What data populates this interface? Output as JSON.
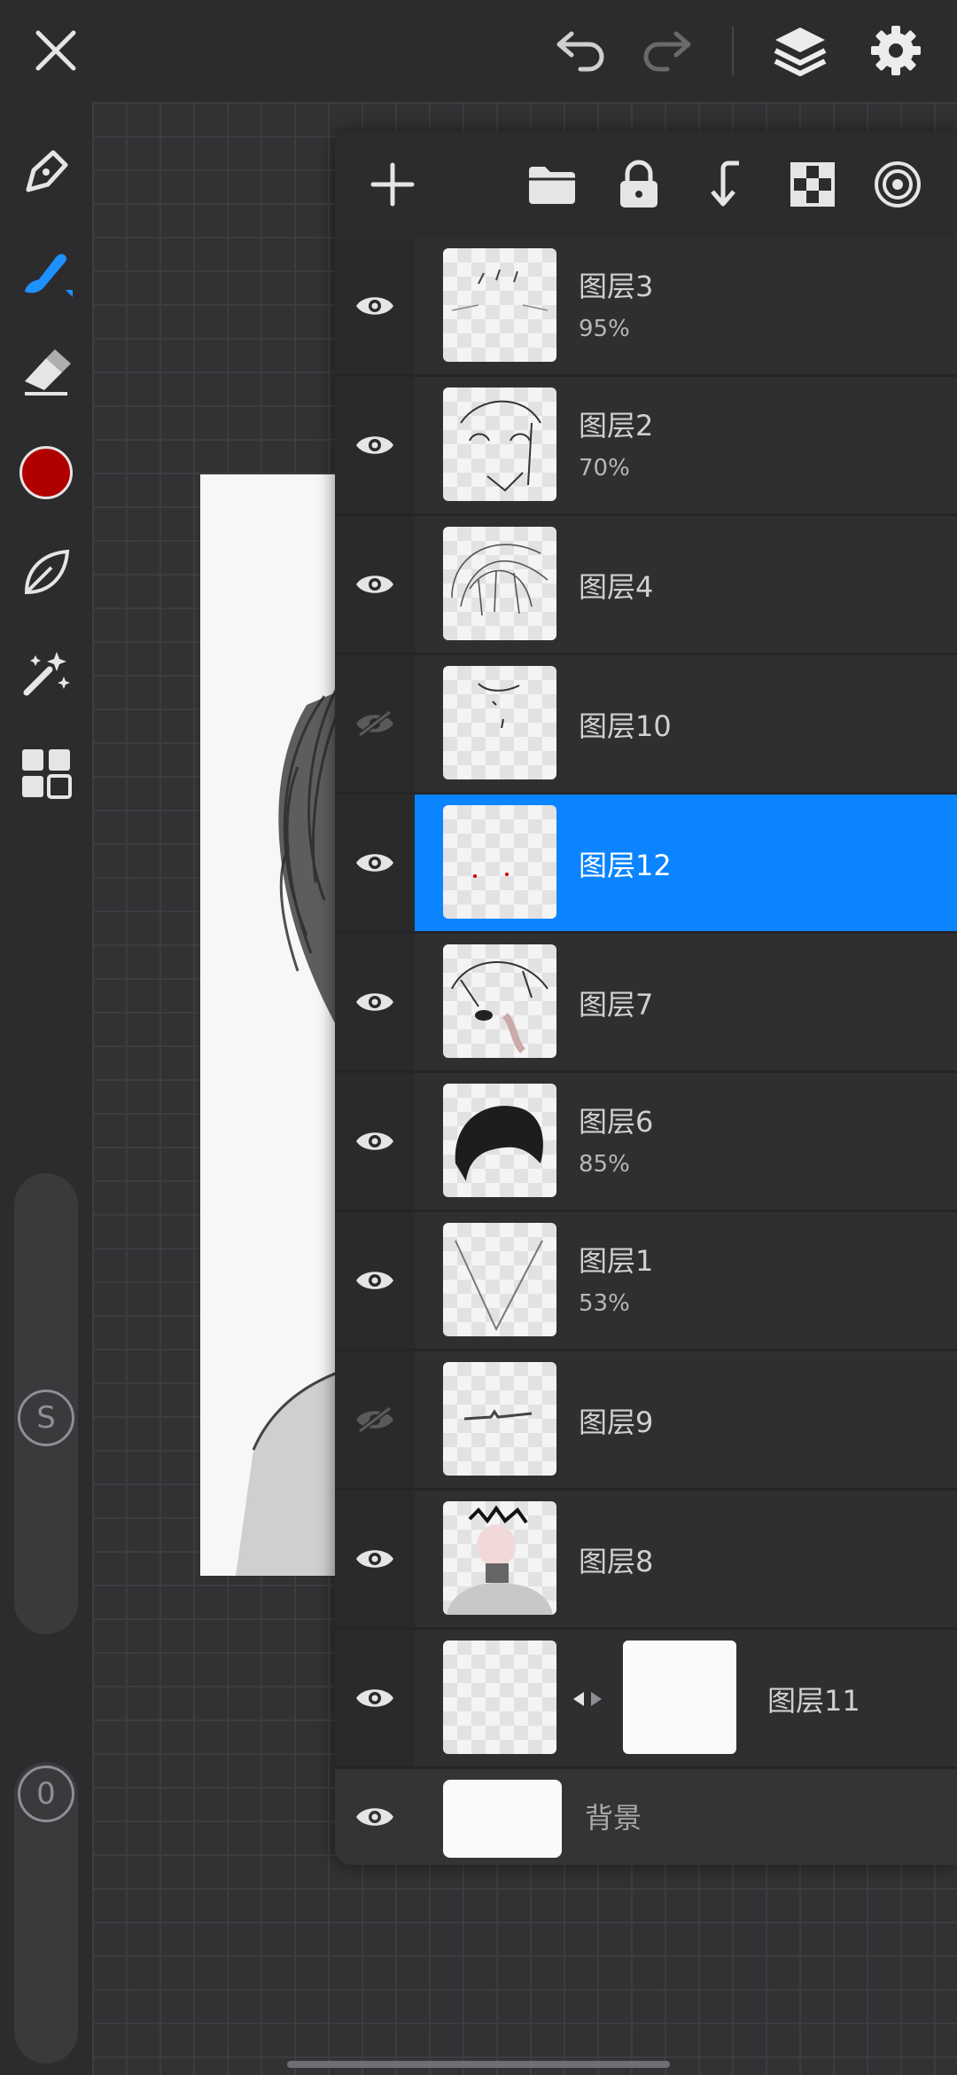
{
  "toolbar": {
    "close_icon": "close-icon",
    "undo_icon": "undo-icon",
    "redo_icon": "redo-icon",
    "layers_icon": "layers-icon",
    "settings_icon": "gear-icon"
  },
  "tools": {
    "brush_color": "#b00000",
    "accent": "#1e90ff",
    "size_slider_label": "S",
    "opacity_slider_label": "0"
  },
  "layer_panel": {
    "selected_color": "#0a84ff",
    "layers": [
      {
        "name": "图层3",
        "opacity": "95%",
        "visible": true
      },
      {
        "name": "图层2",
        "opacity": "70%",
        "visible": true
      },
      {
        "name": "图层4",
        "opacity": "",
        "visible": true
      },
      {
        "name": "图层10",
        "opacity": "",
        "visible": false
      },
      {
        "name": "图层12",
        "opacity": "",
        "visible": true,
        "selected": true
      },
      {
        "name": "图层7",
        "opacity": "",
        "visible": true
      },
      {
        "name": "图层6",
        "opacity": "85%",
        "visible": true
      },
      {
        "name": "图层1",
        "opacity": "53%",
        "visible": true
      },
      {
        "name": "图层9",
        "opacity": "",
        "visible": false
      },
      {
        "name": "图层8",
        "opacity": "",
        "visible": true
      },
      {
        "name": "图层11",
        "opacity": "",
        "visible": true
      },
      {
        "name": "背景",
        "opacity": "",
        "visible": true
      }
    ]
  }
}
